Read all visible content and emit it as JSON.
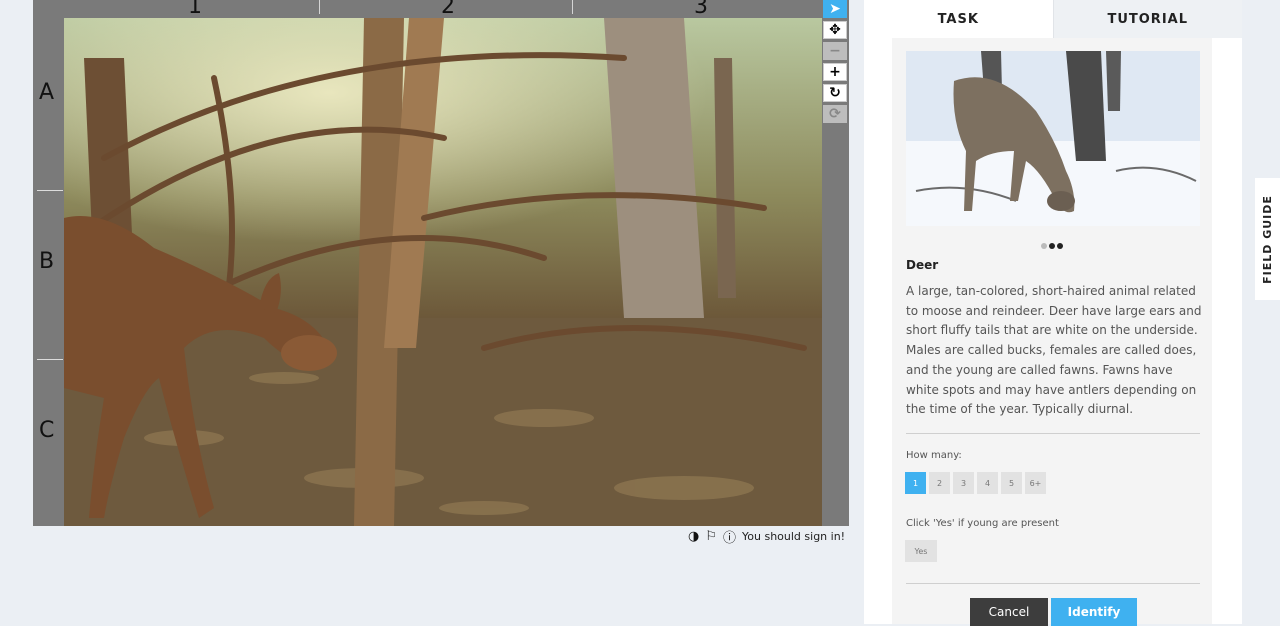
{
  "viewer": {
    "columns": [
      "1",
      "2",
      "3"
    ],
    "rows": [
      "A",
      "B",
      "C"
    ],
    "tools": [
      {
        "name": "pointer-icon",
        "glyph": "➤",
        "state": "active"
      },
      {
        "name": "move-icon",
        "glyph": "✥",
        "state": "normal"
      },
      {
        "name": "zoom-out-icon",
        "glyph": "−",
        "state": "disabled"
      },
      {
        "name": "zoom-in-icon",
        "glyph": "+",
        "state": "normal"
      },
      {
        "name": "rotate-icon",
        "glyph": "↻",
        "state": "normal"
      },
      {
        "name": "reset-icon",
        "glyph": "⟳",
        "state": "disabled"
      }
    ],
    "sign_in_message": "You should sign in!",
    "icons": [
      "contrast-icon",
      "flag-icon",
      "info-icon"
    ]
  },
  "tabs": {
    "task": "TASK",
    "tutorial": "TUTORIAL"
  },
  "animal": {
    "name": "Deer",
    "description": "A large, tan-colored, short-haired animal related to moose and reindeer. Deer have large ears and short fluffy tails that are white on the underside. Males are called bucks, females are called does, and the young are called fawns. Fawns have white spots and may have antlers depending on the time of the year. Typically diurnal.",
    "image_count": 3,
    "active_image": 2
  },
  "questions": {
    "how_many_label": "How many:",
    "count_options": [
      "1",
      "2",
      "3",
      "4",
      "5",
      "6+"
    ],
    "selected_count": "1",
    "young_label": "Click 'Yes' if young are present",
    "yes_label": "Yes"
  },
  "actions": {
    "cancel": "Cancel",
    "identify": "Identify"
  },
  "field_guide": "FIELD GUIDE",
  "colors": {
    "accent": "#3fb1f0",
    "dark_button": "#3d3d3d",
    "page_background": "#ebeff4"
  }
}
